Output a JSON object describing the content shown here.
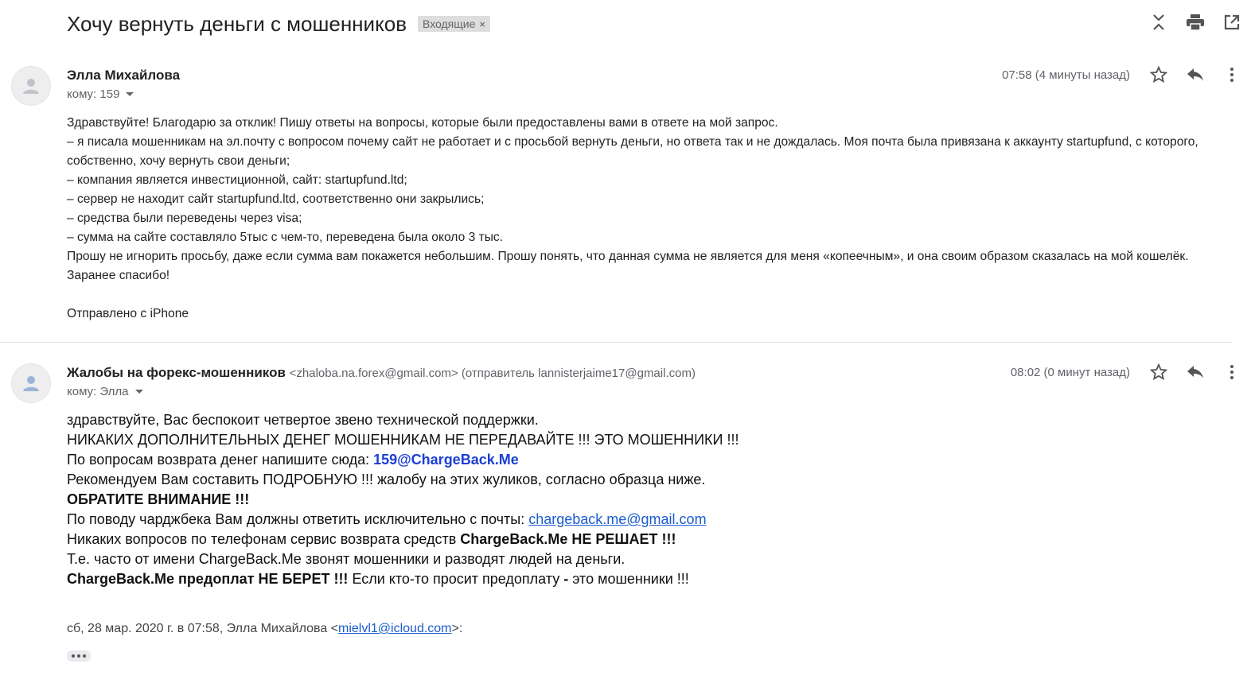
{
  "subject": {
    "title": "Хочу вернуть деньги с мошенников",
    "label": "Входящие",
    "label_remove": "×"
  },
  "top_actions": [
    "collapse-all-icon",
    "print-icon",
    "open-in-new-window-icon"
  ],
  "messages": [
    {
      "sender_name": "Элла Михайлова",
      "recipient_prefix": "кому: 159",
      "time": "07:58 (4 минуты назад)",
      "body": [
        "Здравствуйте! Благодарю за отклик! Пишу ответы на вопросы, которые были предоставлены вами в ответе на мой запрос.",
        "– я писала мошенникам на эл.почту с вопросом почему сайт не работает и с просьбой вернуть деньги, но ответа так и не дождалась. Моя почта была привязана к аккаунту startupfund, с которого, собственно, хочу вернуть свои деньги;",
        "– компания является инвестиционной, сайт: startupfund.ltd;",
        "– сервер не находит сайт startupfund.ltd, соответственно они закрылись;",
        "– средства были переведены через visa;",
        "– сумма на сайте составляло 5тыс с чем-то, переведена была около 3 тыс.",
        "Прошу не игнорить просьбу, даже если сумма вам покажется небольшим. Прошу понять, что данная сумма не является для меня «копеечным», и она своим образом сказалась на мой кошелёк.",
        "Заранее спасибо!",
        "",
        "Отправлено с iPhone"
      ]
    },
    {
      "sender_name": "Жалобы на форекс-мошенников",
      "sender_email": "<zhaloba.na.forex@gmail.com> (отправитель lannisterjaime17@gmail.com)",
      "recipient_prefix": "кому: Элла",
      "time": "08:02 (0 минут назад)",
      "lines": {
        "l1": "здравствуйте, Вас беспокоит четвертое звено технической поддержки.",
        "l2": "НИКАКИХ ДОПОЛНИТЕЛЬНЫХ ДЕНЕГ МОШЕННИКАМ НЕ ПЕРЕДАВАЙТЕ !!! ЭТО МОШЕННИКИ !!!",
        "l3_text": "По вопросам возврата денег напишите сюда: ",
        "l3_email": "159@ChargeBack.Me",
        "l4": "Рекомендуем Вам составить ПОДРОБНУЮ !!! жалобу на этих жуликов, согласно образца ниже.",
        "l5": "ОБРАТИТЕ ВНИМАНИЕ !!!",
        "l6_text": "По поводу чарджбека Вам должны ответить исключительно с почты: ",
        "l6_link": "chargeback.me@gmail.com",
        "l7_text": "Никаких вопросов по телефонам сервис возврата средств ",
        "l7_bold": "ChargeBack.Me НЕ РЕШАЕТ !!!",
        "l8": "Т.е. часто от имени ChargeBack.Me звонят мошенники и разводят людей на деньги.",
        "l9_bold": "ChargeBack.Me предоплат НЕ БЕРЕТ !!!",
        "l9_text": " Если кто-то просит предоплату ",
        "l9_dash": "-",
        "l9_end": " это мошенники !!!"
      },
      "quote_prefix": "сб, 28 мар. 2020 г. в 07:58, Элла Михайлова <",
      "quote_email": "mielvl1@icloud.com",
      "quote_suffix": ">:"
    }
  ]
}
